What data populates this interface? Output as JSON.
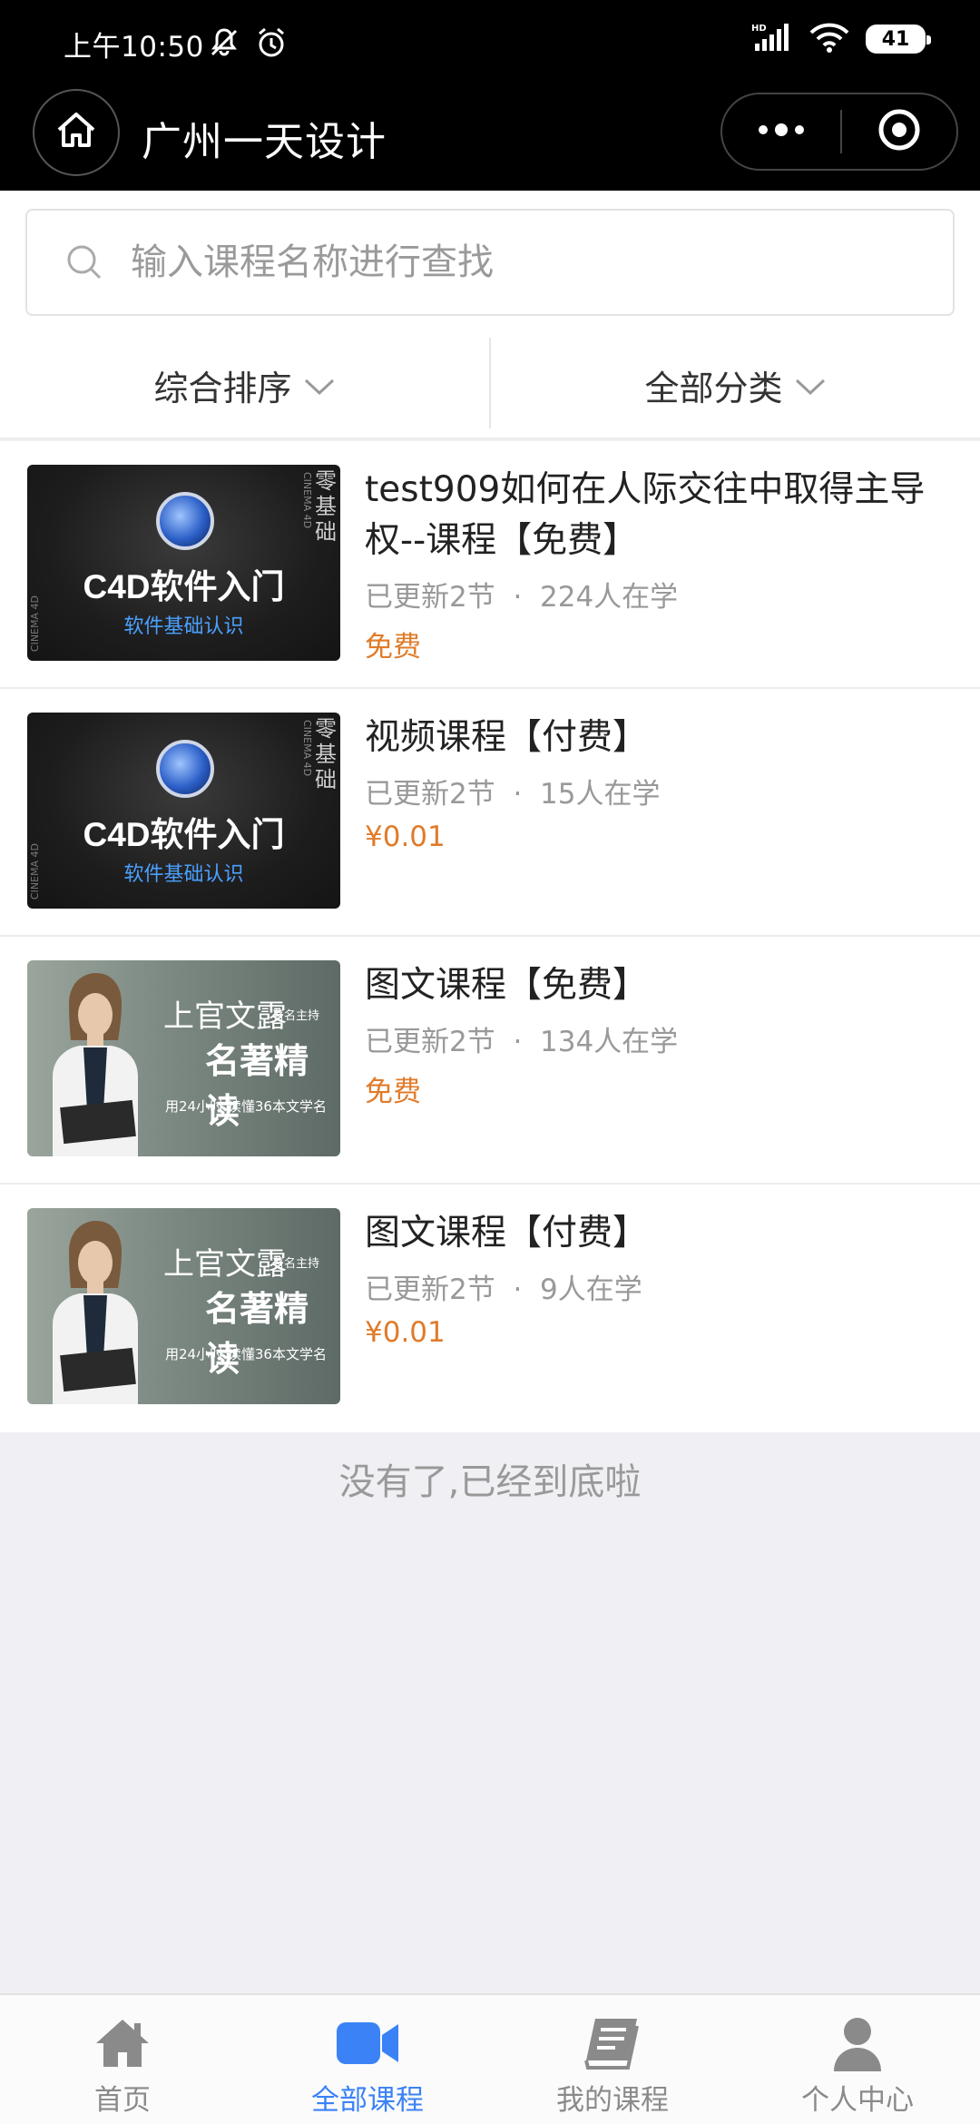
{
  "status_bar": {
    "time": "上午10:50",
    "battery": "41",
    "icons": [
      "mute-icon",
      "alarm-icon",
      "signal-icon",
      "wifi-icon",
      "battery-icon"
    ]
  },
  "navbar": {
    "title": "广州一天设计",
    "icons": [
      "home-icon",
      "more-icon",
      "close-target-icon"
    ]
  },
  "search": {
    "placeholder": "输入课程名称进行查找"
  },
  "filters": [
    {
      "label": "综合排序"
    },
    {
      "label": "全部分类"
    }
  ],
  "courses": [
    {
      "title": "test909如何在人际交往中取得主导权--课程【免费】",
      "updated": "已更新2节",
      "learners": "224人在学",
      "price": "免费",
      "thumb": {
        "type": "c4d",
        "big": "C4D软件入门",
        "small": "软件基础认识",
        "vertical": "零基础",
        "side": "CINEMA 4D"
      }
    },
    {
      "title": "视频课程【付费】",
      "updated": "已更新2节",
      "learners": "15人在学",
      "price": "¥0.01",
      "thumb": {
        "type": "c4d",
        "big": "C4D软件入门",
        "small": "软件基础认识",
        "vertical": "零基础",
        "side": "CINEMA 4D"
      }
    },
    {
      "title": "图文课程【免费】",
      "updated": "已更新2节",
      "learners": "134人在学",
      "price": "免费",
      "thumb": {
        "type": "book",
        "name": "上官文露",
        "main": "名著精读",
        "host": "著名主持",
        "caption": "用24小时 读懂36本文学名"
      }
    },
    {
      "title": "图文课程【付费】",
      "updated": "已更新2节",
      "learners": "9人在学",
      "price": "¥0.01",
      "thumb": {
        "type": "book",
        "name": "上官文露",
        "main": "名著精读",
        "host": "著名主持",
        "caption": "用24小时 读懂36本文学名"
      }
    }
  ],
  "end_text": "没有了,已经到底啦",
  "tabbar": [
    {
      "label": "首页",
      "icon": "home-icon",
      "active": false
    },
    {
      "label": "全部课程",
      "icon": "video-icon",
      "active": true
    },
    {
      "label": "我的课程",
      "icon": "book-icon",
      "active": false
    },
    {
      "label": "个人中心",
      "icon": "user-icon",
      "active": false
    }
  ],
  "colors": {
    "accent": "#3b82f6",
    "price": "#e07b2a",
    "header": "#000000"
  }
}
